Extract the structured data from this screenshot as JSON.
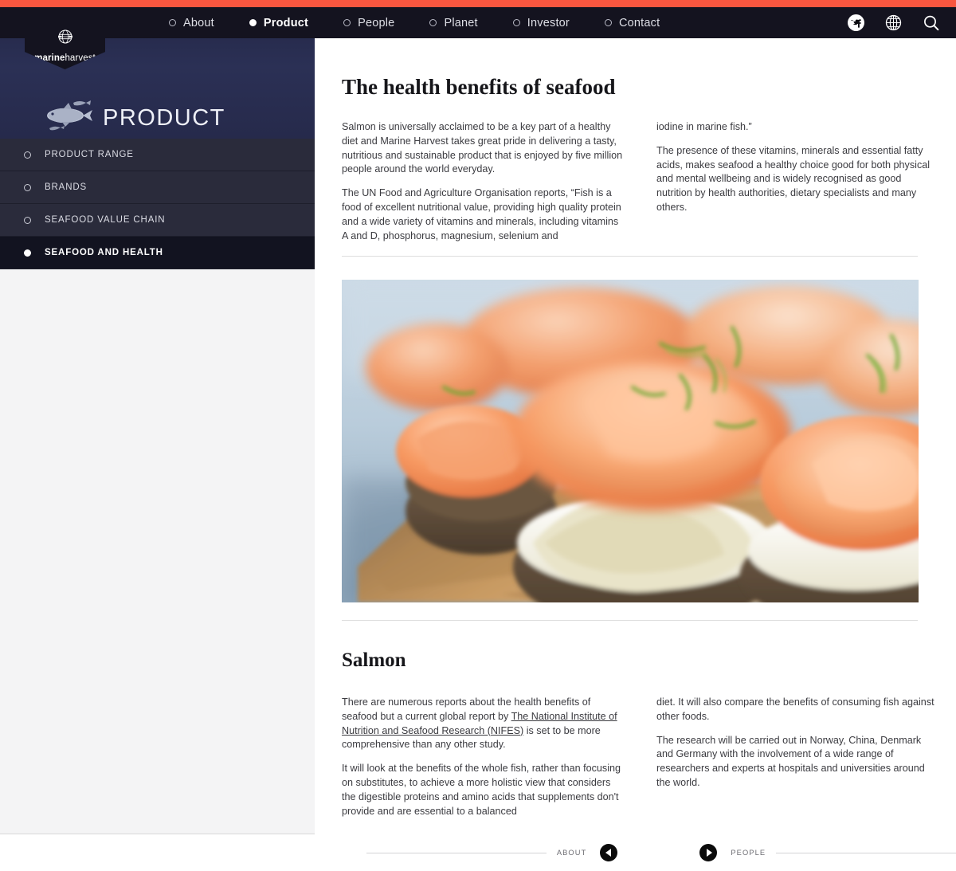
{
  "brand": {
    "logo_text_bold": "marine",
    "logo_text_light": "harvest",
    "logo_icon": "globe-icon",
    "accent_color": "#f9563f",
    "nav_bg_color": "#14131f",
    "hero_bg_color": "#262a4b"
  },
  "nav": {
    "items": [
      {
        "label": "About",
        "active": false
      },
      {
        "label": "Product",
        "active": true
      },
      {
        "label": "People",
        "active": false
      },
      {
        "label": "Planet",
        "active": false
      },
      {
        "label": "Investor",
        "active": false
      },
      {
        "label": "Contact",
        "active": false
      }
    ],
    "icons": [
      {
        "name": "social-twitter-facebook-icon"
      },
      {
        "name": "globe-language-icon"
      },
      {
        "name": "search-icon"
      }
    ]
  },
  "hero": {
    "title": "PRODUCT",
    "illustration": "salmon-fish-icon"
  },
  "sidebar": {
    "items": [
      {
        "label": "PRODUCT RANGE",
        "active": false
      },
      {
        "label": "BRANDS",
        "active": false
      },
      {
        "label": "SEAFOOD VALUE CHAIN",
        "active": false
      },
      {
        "label": "SEAFOOD AND HEALTH",
        "active": true
      }
    ]
  },
  "main": {
    "section1": {
      "heading": "The health benefits of seafood",
      "left_paragraphs": [
        "Salmon is universally acclaimed to be a key part of a healthy diet and Marine Harvest takes great pride in delivering a tasty, nutritious and sustainable product that is enjoyed by five million people around the world everyday.",
        "The UN Food and Agriculture Organisation reports, “Fish is a food of excellent nutritional value, providing high quality protein and a wide variety of vitamins and minerals, including vitamins A and D, phosphorus, magnesium, selenium and"
      ],
      "right_paragraphs": [
        "iodine in marine fish.”",
        "The presence of these vitamins, minerals and essential fatty acids, makes seafood a healthy choice good for both physical and mental wellbeing and is widely recognised as good nutrition by health authorities, dietary specialists and many others."
      ]
    },
    "photo": {
      "alt": "smoked-salmon-canapes-photo"
    },
    "section2": {
      "heading": "Salmon",
      "left_p1_before_link": "There are numerous reports about the health benefits of seafood but a current global report by ",
      "left_p1_link": "The National Institute of Nutrition and Seafood Research (NIFES)",
      "left_p1_after_link": " is set to be more comprehensive than any other study.",
      "left_p2": "It will look at the benefits of the whole fish, rather than focusing on substitutes, to achieve a more holistic view that considers the digestible proteins and amino acids that supplements don't provide and are essential to a balanced",
      "right_paragraphs": [
        "diet. It will also compare the benefits of consuming fish against other foods.",
        "The research will be carried out in Norway, China, Denmark and Germany with the involvement of a wide range of researchers and experts at hospitals and universities around the world."
      ]
    }
  },
  "pager": {
    "prev_label": "ABOUT",
    "next_label": "PEOPLE"
  }
}
